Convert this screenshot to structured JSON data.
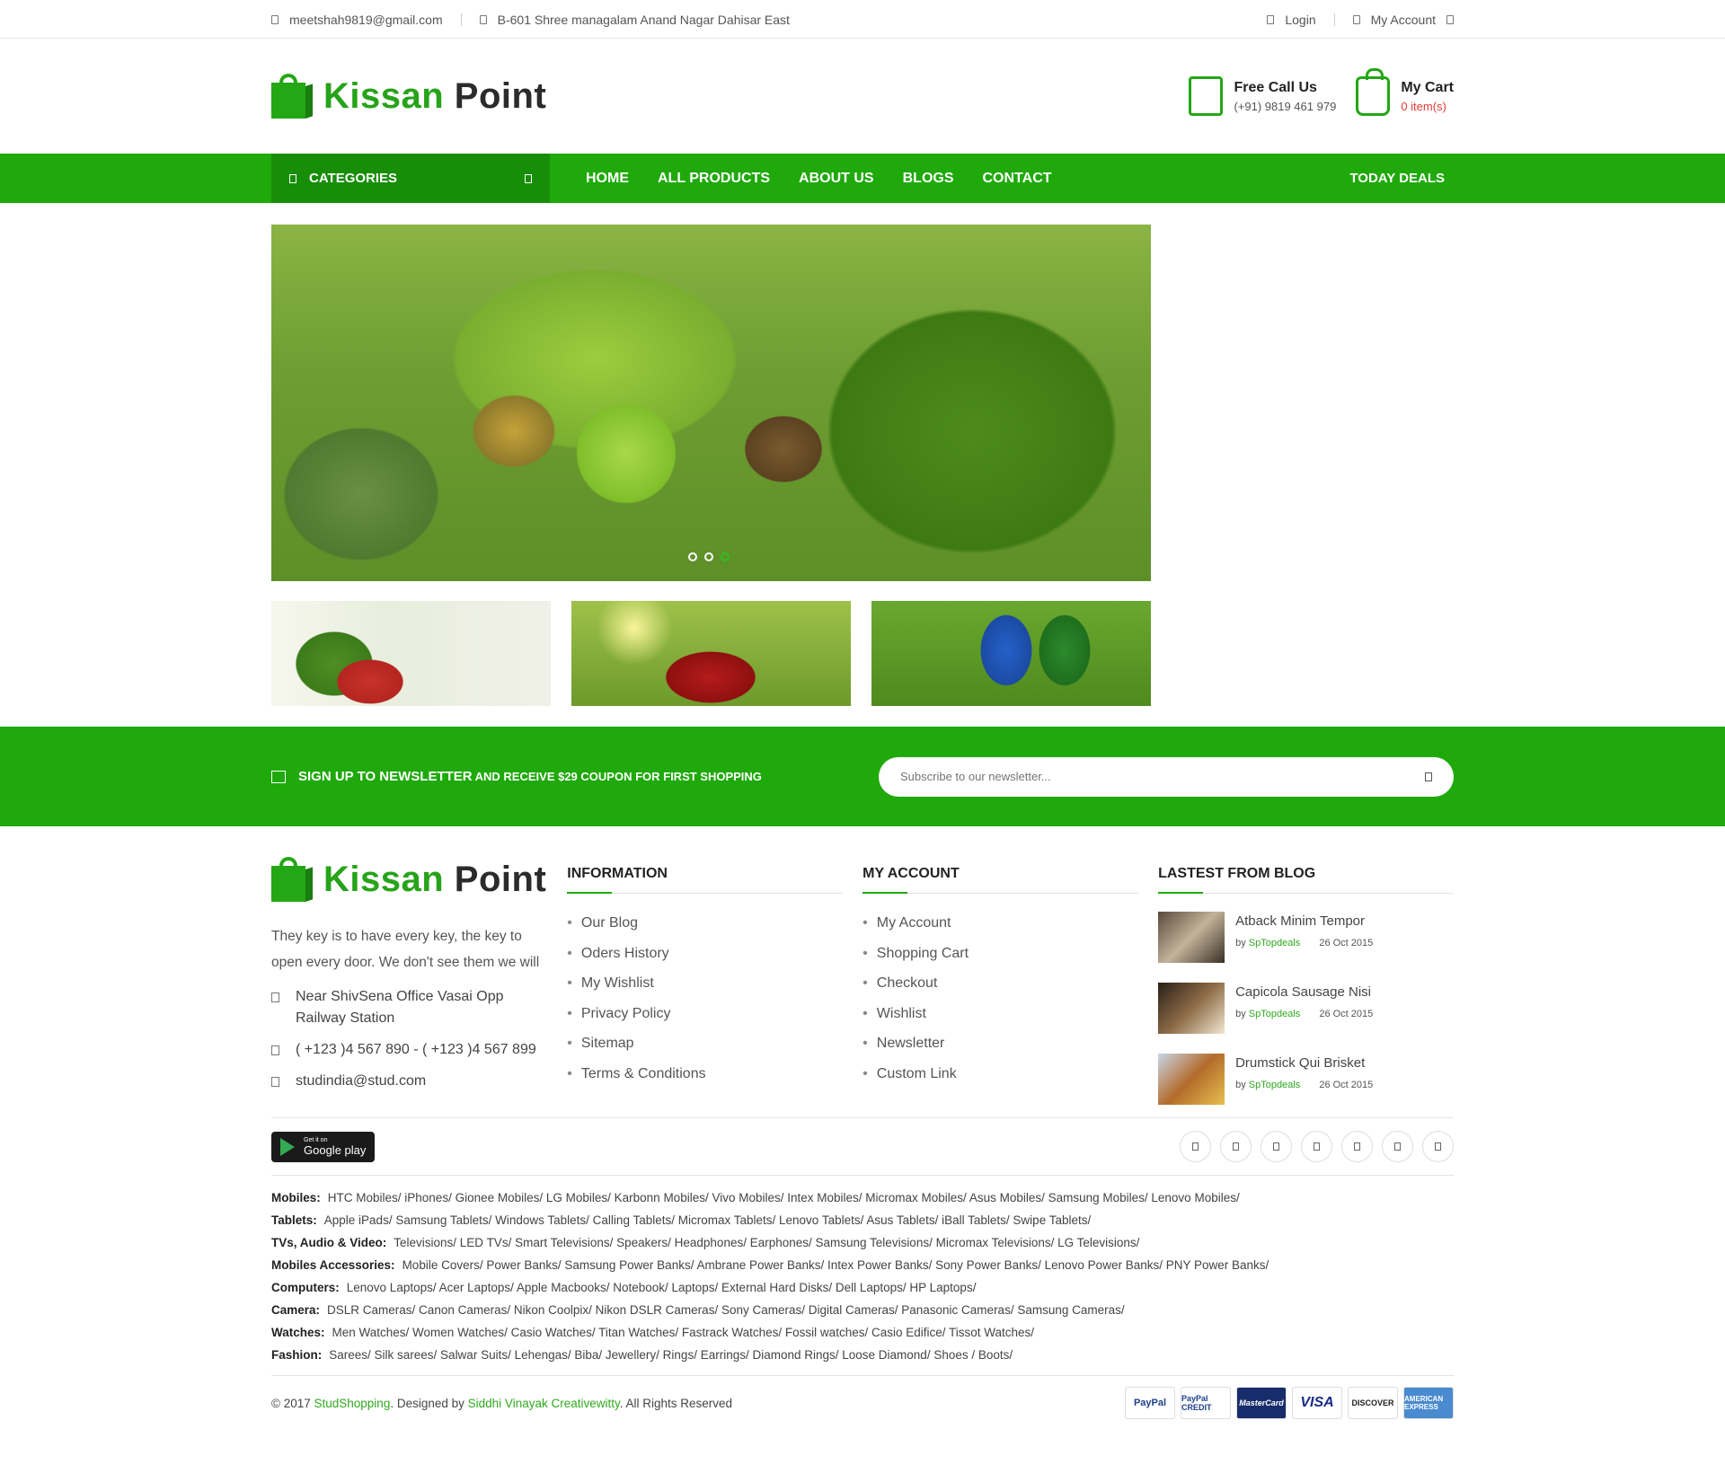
{
  "topbar": {
    "email": "meetshah9819@gmail.com",
    "address": "B-601 Shree managalam Anand Nagar Dahisar East",
    "login": "Login",
    "my_account": "My Account"
  },
  "brand": {
    "name_green": "Kissan",
    "name_dark": "Point"
  },
  "header": {
    "call_title": "Free Call Us",
    "call_number": "(+91) 9819 461 979",
    "cart_title": "My Cart",
    "cart_items": "0 item(s)"
  },
  "nav": {
    "categories": "CATEGORIES",
    "items": [
      "HOME",
      "ALL PRODUCTS",
      "ABOUT US",
      "BLOGS",
      "CONTACT"
    ],
    "today_deals": "TODAY DEALS"
  },
  "slider": {
    "slides": 3,
    "active_slide": 3
  },
  "newsletter": {
    "title": "SIGN UP TO NEWSLETTER",
    "subtitle": "AND RECEIVE $29 COUPON FOR FIRST SHOPPING",
    "placeholder": "Subscribe to our newsletter..."
  },
  "footer": {
    "about_text": "They key is to have every key, the key to open every door. We don't see them we will",
    "address": "Near ShivSena Office Vasai Opp Railway Station",
    "phone": "( +123 )4 567 890 - ( +123 )4 567 899",
    "email": "studindia@stud.com",
    "information": {
      "title": "INFORMATION",
      "links": [
        "Our Blog",
        "Oders History",
        "My Wishlist",
        "Privacy Policy",
        "Sitemap",
        "Terms & Conditions"
      ]
    },
    "account": {
      "title": "MY ACCOUNT",
      "links": [
        "My Account",
        "Shopping Cart",
        "Checkout",
        "Wishlist",
        "Newsletter",
        "Custom Link"
      ]
    },
    "blog": {
      "title": "LASTEST FROM BLOG",
      "posts": [
        {
          "title": "Atback Minim Tempor",
          "by_prefix": "by",
          "author": "SpTopdeals",
          "date": "26 Oct 2015"
        },
        {
          "title": "Capicola Sausage Nisi",
          "by_prefix": "by",
          "author": "SpTopdeals",
          "date": "26 Oct 2015"
        },
        {
          "title": "Drumstick Qui Brisket",
          "by_prefix": "by",
          "author": "SpTopdeals",
          "date": "26 Oct 2015"
        }
      ]
    },
    "gplay_small": "Get it on",
    "gplay_big": "Google play"
  },
  "directory": [
    {
      "key": "Mobiles:",
      "value": "HTC Mobiles/ iPhones/ Gionee Mobiles/ LG Mobiles/ Karbonn Mobiles/ Vivo Mobiles/ Intex Mobiles/ Micromax Mobiles/ Asus Mobiles/ Samsung Mobiles/ Lenovo Mobiles/"
    },
    {
      "key": "Tablets:",
      "value": "Apple iPads/ Samsung Tablets/ Windows Tablets/ Calling Tablets/ Micromax Tablets/ Lenovo Tablets/ Asus Tablets/ iBall Tablets/ Swipe Tablets/"
    },
    {
      "key": "TVs, Audio & Video:",
      "value": "Televisions/ LED TVs/ Smart Televisions/ Speakers/ Headphones/ Earphones/ Samsung Televisions/ Micromax Televisions/ LG Televisions/"
    },
    {
      "key": "Mobiles Accessories:",
      "value": "Mobile Covers/ Power Banks/ Samsung Power Banks/ Ambrane Power Banks/ Intex Power Banks/ Sony Power Banks/ Lenovo Power Banks/ PNY Power Banks/"
    },
    {
      "key": "Computers:",
      "value": "Lenovo Laptops/ Acer Laptops/ Apple Macbooks/ Notebook/ Laptops/ External Hard Disks/ Dell Laptops/ HP Laptops/"
    },
    {
      "key": "Camera:",
      "value": "DSLR Cameras/ Canon Cameras/ Nikon Coolpix/ Nikon DSLR Cameras/ Sony Cameras/ Digital Cameras/ Panasonic Cameras/ Samsung Cameras/"
    },
    {
      "key": "Watches:",
      "value": "Men Watches/ Women Watches/ Casio Watches/ Titan Watches/ Fastrack Watches/ Fossil watches/ Casio Edifice/ Tissot Watches/"
    },
    {
      "key": "Fashion:",
      "value": "Sarees/ Silk sarees/ Salwar Suits/ Lehengas/ Biba/ Jewellery/ Rings/ Earrings/ Diamond Rings/ Loose Diamond/ Shoes / Boots/"
    }
  ],
  "copyright": {
    "prefix": "© 2017",
    "site": "StudShopping",
    "designed": ". Designed by",
    "designer": "Siddhi Vinayak Creativewitty",
    "suffix": ". All Rights Reserved"
  },
  "payments": [
    "PayPal",
    "PayPal CREDIT",
    "MasterCard",
    "VISA",
    "DISCOVER",
    "AMERICAN EXPRESS"
  ],
  "colors": {
    "brand_green": "#1fa90b",
    "brand_dark_green": "#188d08",
    "cart_red": "#e53935"
  }
}
